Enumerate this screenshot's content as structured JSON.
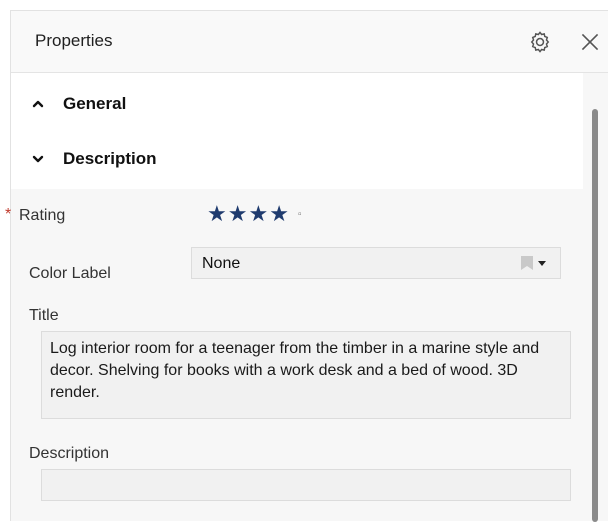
{
  "header": {
    "title": "Properties",
    "settings_icon": "gear-icon",
    "close_icon": "close-icon"
  },
  "sections": [
    {
      "label": "General",
      "state": "collapsed",
      "icon": "chevron-up-icon"
    },
    {
      "label": "Description",
      "state": "expanded",
      "icon": "chevron-down-icon"
    }
  ],
  "fields": {
    "rating": {
      "label": "Rating",
      "required_marker": "*",
      "stars_filled": 4,
      "stars_total": 5,
      "star_glyph": "★",
      "empty_glyph": "▫"
    },
    "color_label": {
      "label": "Color Label",
      "value": "None"
    },
    "title": {
      "label": "Title",
      "value": "Log interior room for a teenager from the timber in a marine style and decor. Shelving for books with a work desk and a bed of wood. 3D render."
    },
    "description": {
      "label": "Description",
      "value": ""
    }
  },
  "colors": {
    "star": "#1f3b6e",
    "required": "#c0392b",
    "panel_bg": "#f7f7f7",
    "field_bg": "#f1f1f1"
  }
}
